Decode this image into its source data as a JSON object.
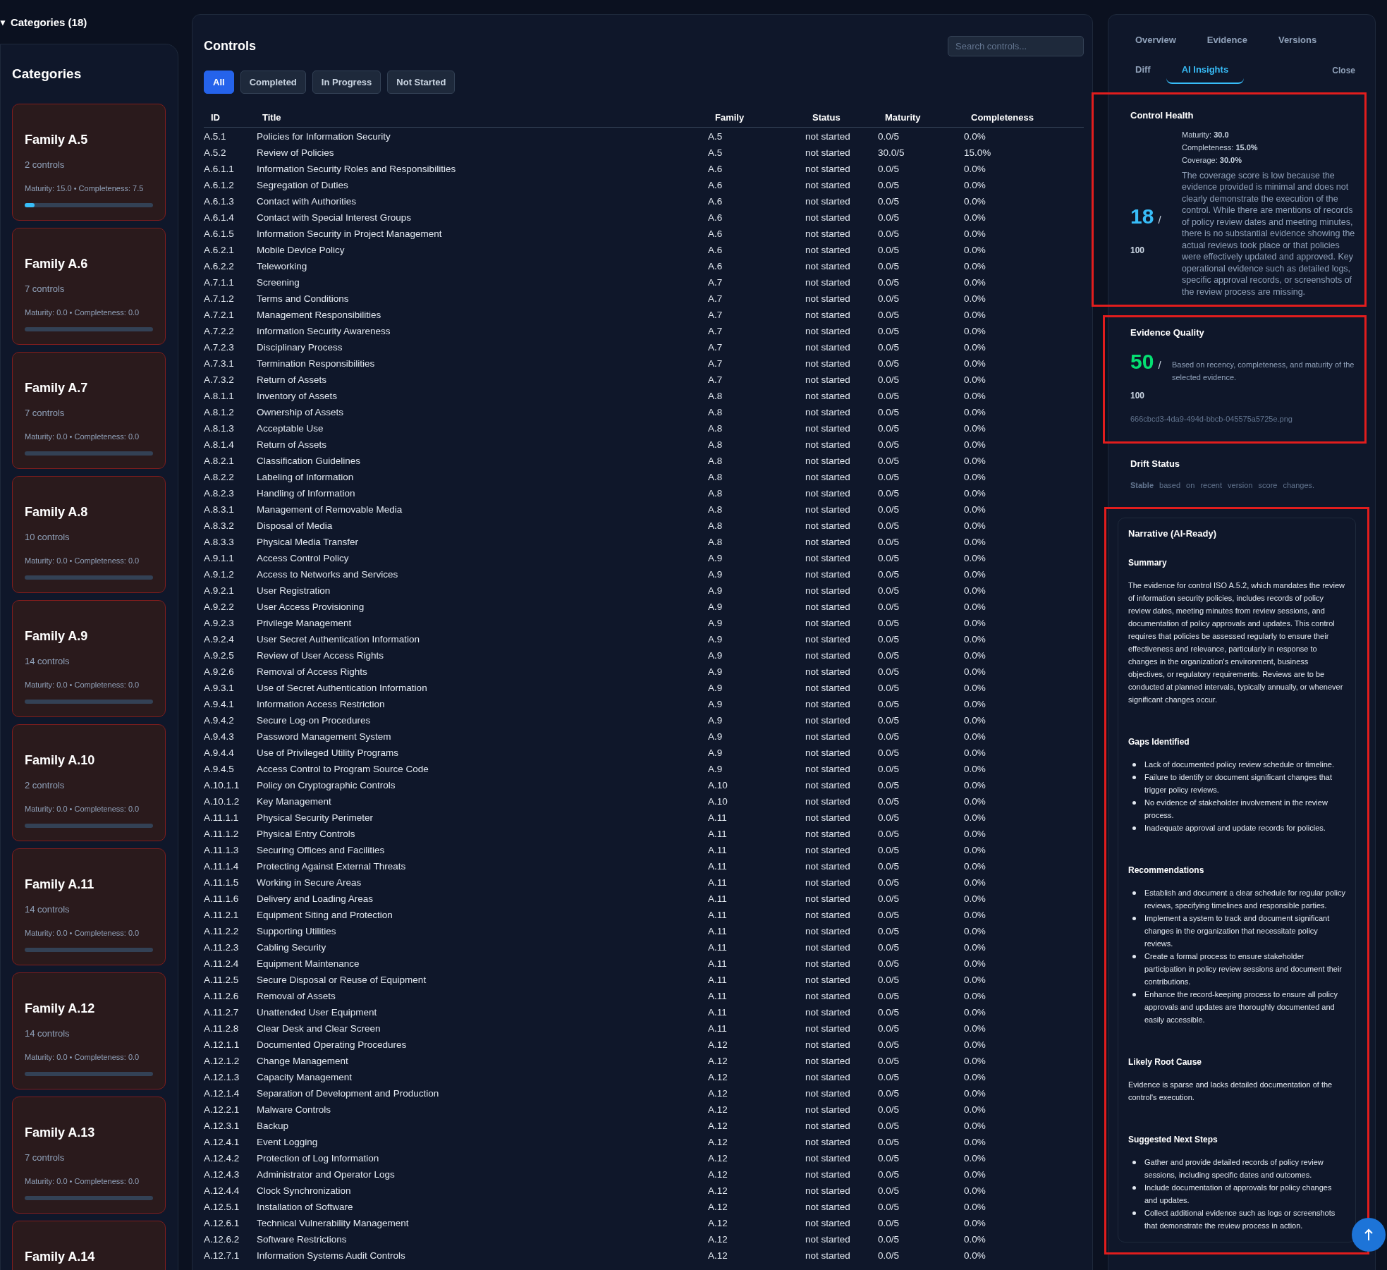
{
  "sidebar": {
    "toggle": "▼",
    "summary": "Categories (18)",
    "expanded": true,
    "heading": "Categories",
    "categories": [
      {
        "name": "Family A.5",
        "count": "2 controls",
        "stats": "Maturity: 15.0 • Completeness: 7.5",
        "level": 0.075
      },
      {
        "name": "Family A.6",
        "count": "7 controls",
        "stats": "Maturity: 0.0 • Completeness: 0.0",
        "level": 0
      },
      {
        "name": "Family A.7",
        "count": "7 controls",
        "stats": "Maturity: 0.0 • Completeness: 0.0",
        "level": 0
      },
      {
        "name": "Family A.8",
        "count": "10 controls",
        "stats": "Maturity: 0.0 • Completeness: 0.0",
        "level": 0
      },
      {
        "name": "Family A.9",
        "count": "14 controls",
        "stats": "Maturity: 0.0 • Completeness: 0.0",
        "level": 0
      },
      {
        "name": "Family A.10",
        "count": "2 controls",
        "stats": "Maturity: 0.0 • Completeness: 0.0",
        "level": 0
      },
      {
        "name": "Family A.11",
        "count": "14 controls",
        "stats": "Maturity: 0.0 • Completeness: 0.0",
        "level": 0
      },
      {
        "name": "Family A.12",
        "count": "14 controls",
        "stats": "Maturity: 0.0 • Completeness: 0.0",
        "level": 0
      },
      {
        "name": "Family A.13",
        "count": "7 controls",
        "stats": "Maturity: 0.0 • Completeness: 0.0",
        "level": 0
      },
      {
        "name": "Family A.14"
      }
    ]
  },
  "controls": {
    "title": "Controls",
    "search": {
      "placeholder": "Search controls..."
    },
    "filters": [
      {
        "label": "All",
        "selected": true
      },
      {
        "label": "Completed",
        "selected": false
      },
      {
        "label": "In Progress",
        "selected": false
      },
      {
        "label": "Not Started",
        "selected": false
      }
    ],
    "table": {
      "columns": [
        "ID",
        "Title",
        "Family",
        "Status",
        "Maturity",
        "Completeness"
      ],
      "rows": [
        [
          "A.5.1",
          "Policies for Information Security",
          "A.5",
          "not started",
          "0.0/5",
          "0.0%"
        ],
        [
          "A.5.2",
          "Review of Policies",
          "A.5",
          "not started",
          "30.0/5",
          "15.0%"
        ],
        [
          "A.6.1.1",
          "Information Security Roles and Responsibilities",
          "A.6",
          "not started",
          "0.0/5",
          "0.0%"
        ],
        [
          "A.6.1.2",
          "Segregation of Duties",
          "A.6",
          "not started",
          "0.0/5",
          "0.0%"
        ],
        [
          "A.6.1.3",
          "Contact with Authorities",
          "A.6",
          "not started",
          "0.0/5",
          "0.0%"
        ],
        [
          "A.6.1.4",
          "Contact with Special Interest Groups",
          "A.6",
          "not started",
          "0.0/5",
          "0.0%"
        ],
        [
          "A.6.1.5",
          "Information Security in Project Management",
          "A.6",
          "not started",
          "0.0/5",
          "0.0%"
        ],
        [
          "A.6.2.1",
          "Mobile Device Policy",
          "A.6",
          "not started",
          "0.0/5",
          "0.0%"
        ],
        [
          "A.6.2.2",
          "Teleworking",
          "A.6",
          "not started",
          "0.0/5",
          "0.0%"
        ],
        [
          "A.7.1.1",
          "Screening",
          "A.7",
          "not started",
          "0.0/5",
          "0.0%"
        ],
        [
          "A.7.1.2",
          "Terms and Conditions",
          "A.7",
          "not started",
          "0.0/5",
          "0.0%"
        ],
        [
          "A.7.2.1",
          "Management Responsibilities",
          "A.7",
          "not started",
          "0.0/5",
          "0.0%"
        ],
        [
          "A.7.2.2",
          "Information Security Awareness",
          "A.7",
          "not started",
          "0.0/5",
          "0.0%"
        ],
        [
          "A.7.2.3",
          "Disciplinary Process",
          "A.7",
          "not started",
          "0.0/5",
          "0.0%"
        ],
        [
          "A.7.3.1",
          "Termination Responsibilities",
          "A.7",
          "not started",
          "0.0/5",
          "0.0%"
        ],
        [
          "A.7.3.2",
          "Return of Assets",
          "A.7",
          "not started",
          "0.0/5",
          "0.0%"
        ],
        [
          "A.8.1.1",
          "Inventory of Assets",
          "A.8",
          "not started",
          "0.0/5",
          "0.0%"
        ],
        [
          "A.8.1.2",
          "Ownership of Assets",
          "A.8",
          "not started",
          "0.0/5",
          "0.0%"
        ],
        [
          "A.8.1.3",
          "Acceptable Use",
          "A.8",
          "not started",
          "0.0/5",
          "0.0%"
        ],
        [
          "A.8.1.4",
          "Return of Assets",
          "A.8",
          "not started",
          "0.0/5",
          "0.0%"
        ],
        [
          "A.8.2.1",
          "Classification Guidelines",
          "A.8",
          "not started",
          "0.0/5",
          "0.0%"
        ],
        [
          "A.8.2.2",
          "Labeling of Information",
          "A.8",
          "not started",
          "0.0/5",
          "0.0%"
        ],
        [
          "A.8.2.3",
          "Handling of Information",
          "A.8",
          "not started",
          "0.0/5",
          "0.0%"
        ],
        [
          "A.8.3.1",
          "Management of Removable Media",
          "A.8",
          "not started",
          "0.0/5",
          "0.0%"
        ],
        [
          "A.8.3.2",
          "Disposal of Media",
          "A.8",
          "not started",
          "0.0/5",
          "0.0%"
        ],
        [
          "A.8.3.3",
          "Physical Media Transfer",
          "A.8",
          "not started",
          "0.0/5",
          "0.0%"
        ],
        [
          "A.9.1.1",
          "Access Control Policy",
          "A.9",
          "not started",
          "0.0/5",
          "0.0%"
        ],
        [
          "A.9.1.2",
          "Access to Networks and Services",
          "A.9",
          "not started",
          "0.0/5",
          "0.0%"
        ],
        [
          "A.9.2.1",
          "User Registration",
          "A.9",
          "not started",
          "0.0/5",
          "0.0%"
        ],
        [
          "A.9.2.2",
          "User Access Provisioning",
          "A.9",
          "not started",
          "0.0/5",
          "0.0%"
        ],
        [
          "A.9.2.3",
          "Privilege Management",
          "A.9",
          "not started",
          "0.0/5",
          "0.0%"
        ],
        [
          "A.9.2.4",
          "User Secret Authentication Information",
          "A.9",
          "not started",
          "0.0/5",
          "0.0%"
        ],
        [
          "A.9.2.5",
          "Review of User Access Rights",
          "A.9",
          "not started",
          "0.0/5",
          "0.0%"
        ],
        [
          "A.9.2.6",
          "Removal of Access Rights",
          "A.9",
          "not started",
          "0.0/5",
          "0.0%"
        ],
        [
          "A.9.3.1",
          "Use of Secret Authentication Information",
          "A.9",
          "not started",
          "0.0/5",
          "0.0%"
        ],
        [
          "A.9.4.1",
          "Information Access Restriction",
          "A.9",
          "not started",
          "0.0/5",
          "0.0%"
        ],
        [
          "A.9.4.2",
          "Secure Log-on Procedures",
          "A.9",
          "not started",
          "0.0/5",
          "0.0%"
        ],
        [
          "A.9.4.3",
          "Password Management System",
          "A.9",
          "not started",
          "0.0/5",
          "0.0%"
        ],
        [
          "A.9.4.4",
          "Use of Privileged Utility Programs",
          "A.9",
          "not started",
          "0.0/5",
          "0.0%"
        ],
        [
          "A.9.4.5",
          "Access Control to Program Source Code",
          "A.9",
          "not started",
          "0.0/5",
          "0.0%"
        ],
        [
          "A.10.1.1",
          "Policy on Cryptographic Controls",
          "A.10",
          "not started",
          "0.0/5",
          "0.0%"
        ],
        [
          "A.10.1.2",
          "Key Management",
          "A.10",
          "not started",
          "0.0/5",
          "0.0%"
        ],
        [
          "A.11.1.1",
          "Physical Security Perimeter",
          "A.11",
          "not started",
          "0.0/5",
          "0.0%"
        ],
        [
          "A.11.1.2",
          "Physical Entry Controls",
          "A.11",
          "not started",
          "0.0/5",
          "0.0%"
        ],
        [
          "A.11.1.3",
          "Securing Offices and Facilities",
          "A.11",
          "not started",
          "0.0/5",
          "0.0%"
        ],
        [
          "A.11.1.4",
          "Protecting Against External Threats",
          "A.11",
          "not started",
          "0.0/5",
          "0.0%"
        ],
        [
          "A.11.1.5",
          "Working in Secure Areas",
          "A.11",
          "not started",
          "0.0/5",
          "0.0%"
        ],
        [
          "A.11.1.6",
          "Delivery and Loading Areas",
          "A.11",
          "not started",
          "0.0/5",
          "0.0%"
        ],
        [
          "A.11.2.1",
          "Equipment Siting and Protection",
          "A.11",
          "not started",
          "0.0/5",
          "0.0%"
        ],
        [
          "A.11.2.2",
          "Supporting Utilities",
          "A.11",
          "not started",
          "0.0/5",
          "0.0%"
        ],
        [
          "A.11.2.3",
          "Cabling Security",
          "A.11",
          "not started",
          "0.0/5",
          "0.0%"
        ],
        [
          "A.11.2.4",
          "Equipment Maintenance",
          "A.11",
          "not started",
          "0.0/5",
          "0.0%"
        ],
        [
          "A.11.2.5",
          "Secure Disposal or Reuse of Equipment",
          "A.11",
          "not started",
          "0.0/5",
          "0.0%"
        ],
        [
          "A.11.2.6",
          "Removal of Assets",
          "A.11",
          "not started",
          "0.0/5",
          "0.0%"
        ],
        [
          "A.11.2.7",
          "Unattended User Equipment",
          "A.11",
          "not started",
          "0.0/5",
          "0.0%"
        ],
        [
          "A.11.2.8",
          "Clear Desk and Clear Screen",
          "A.11",
          "not started",
          "0.0/5",
          "0.0%"
        ],
        [
          "A.12.1.1",
          "Documented Operating Procedures",
          "A.12",
          "not started",
          "0.0/5",
          "0.0%"
        ],
        [
          "A.12.1.2",
          "Change Management",
          "A.12",
          "not started",
          "0.0/5",
          "0.0%"
        ],
        [
          "A.12.1.3",
          "Capacity Management",
          "A.12",
          "not started",
          "0.0/5",
          "0.0%"
        ],
        [
          "A.12.1.4",
          "Separation of Development and Production",
          "A.12",
          "not started",
          "0.0/5",
          "0.0%"
        ],
        [
          "A.12.2.1",
          "Malware Controls",
          "A.12",
          "not started",
          "0.0/5",
          "0.0%"
        ],
        [
          "A.12.3.1",
          "Backup",
          "A.12",
          "not started",
          "0.0/5",
          "0.0%"
        ],
        [
          "A.12.4.1",
          "Event Logging",
          "A.12",
          "not started",
          "0.0/5",
          "0.0%"
        ],
        [
          "A.12.4.2",
          "Protection of Log Information",
          "A.12",
          "not started",
          "0.0/5",
          "0.0%"
        ],
        [
          "A.12.4.3",
          "Administrator and Operator Logs",
          "A.12",
          "not started",
          "0.0/5",
          "0.0%"
        ],
        [
          "A.12.4.4",
          "Clock Synchronization",
          "A.12",
          "not started",
          "0.0/5",
          "0.0%"
        ],
        [
          "A.12.5.1",
          "Installation of Software",
          "A.12",
          "not started",
          "0.0/5",
          "0.0%"
        ],
        [
          "A.12.6.1",
          "Technical Vulnerability Management",
          "A.12",
          "not started",
          "0.0/5",
          "0.0%"
        ],
        [
          "A.12.6.2",
          "Software Restrictions",
          "A.12",
          "not started",
          "0.0/5",
          "0.0%"
        ],
        [
          "A.12.7.1",
          "Information Systems Audit Controls",
          "A.12",
          "not started",
          "0.0/5",
          "0.0%"
        ]
      ]
    }
  },
  "details": {
    "tabs": [
      {
        "label": "Overview",
        "selected": false
      },
      {
        "label": "Evidence",
        "selected": false
      },
      {
        "label": "Versions",
        "selected": false
      },
      {
        "label": "Diff",
        "selected": false
      },
      {
        "label": "AI Insights",
        "selected": true
      }
    ],
    "close": "Close",
    "control_health": {
      "title": "Control Health",
      "highlighted": true,
      "score": "18",
      "slash": "/",
      "max": "100",
      "metrics": [
        "Maturity: **30.0**",
        "Completeness: **15.0%**",
        "Coverage: **30.0%**"
      ],
      "text": "The coverage score is low because the evidence provided is minimal and does not clearly demonstrate the execution of the control. While there are mentions of records of policy review dates and meeting minutes, there is no substantial evidence showing the actual reviews took place or that policies were effectively updated and approved. Key operational evidence such as detailed logs, specific approval records, or screenshots of the review process are missing."
    },
    "evidence_quality": {
      "title": "Evidence Quality",
      "highlighted": true,
      "score": "50",
      "slash": "/",
      "max": "100",
      "text": "Based on recency, completeness, and maturity of the selected evidence.",
      "file": "666cbcd3-4da9-494d-bbcb-045575a5725e.png"
    },
    "drift_status": {
      "title": "Drift Status",
      "highlighted": false,
      "text": "**Stable** based on recent version score changes."
    },
    "narrative": {
      "title": "Narrative (AI-Ready)",
      "highlighted": true,
      "sections": [
        {
          "kind": "paragraph",
          "heading": "Summary",
          "text": "The evidence for control ISO A.5.2, which mandates the review of information security policies, includes records of policy review dates, meeting minutes from review sessions, and documentation of policy approvals and updates. This control requires that policies be assessed regularly to ensure their effectiveness and relevance, particularly in response to changes in the organization's environment, business objectives, or regulatory requirements. Reviews are to be conducted at planned intervals, typically annually, or whenever significant changes occur."
        },
        {
          "kind": "list",
          "heading": "Gaps Identified",
          "items": [
            "Lack of documented policy review schedule or timeline.",
            "Failure to identify or document significant changes that trigger policy reviews.",
            "No evidence of stakeholder involvement in the review process.",
            "Inadequate approval and update records for policies."
          ]
        },
        {
          "kind": "list",
          "heading": "Recommendations",
          "items": [
            "Establish and document a clear schedule for regular policy reviews, specifying timelines and responsible parties.",
            "Implement a system to track and document significant changes in the organization that necessitate policy reviews.",
            "Create a formal process to ensure stakeholder participation in policy review sessions and document their contributions.",
            "Enhance the record-keeping process to ensure all policy approvals and updates are thoroughly documented and easily accessible."
          ]
        },
        {
          "kind": "paragraph",
          "heading": "Likely Root Cause",
          "text": "Evidence is sparse and lacks detailed documentation of the control's execution."
        },
        {
          "kind": "list",
          "heading": "Suggested Next Steps",
          "items": [
            "Gather and provide detailed records of policy review sessions, including specific dates and outcomes.",
            "Include documentation of approvals for policy changes and updates.",
            "Collect additional evidence such as logs or screenshots that demonstrate the review process in action."
          ]
        }
      ]
    }
  }
}
